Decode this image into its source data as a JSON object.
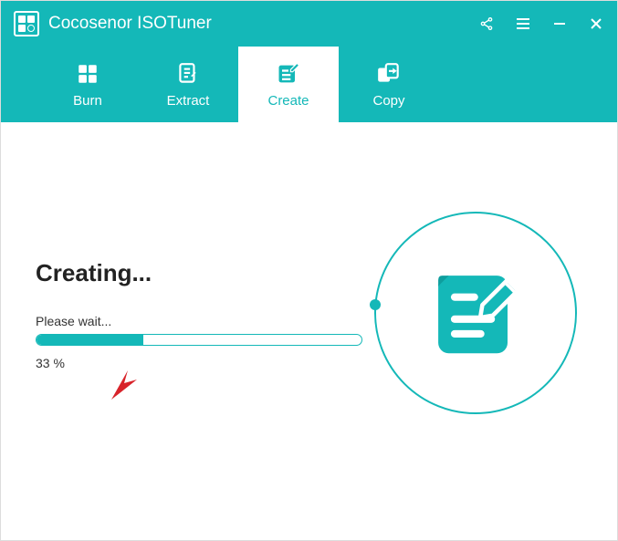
{
  "app": {
    "title": "Cocosenor ISOTuner"
  },
  "tabs": {
    "burn": "Burn",
    "extract": "Extract",
    "create": "Create",
    "copy": "Copy"
  },
  "main": {
    "heading": "Creating...",
    "wait": "Please wait...",
    "percent_text": "33 %",
    "percent_value": 33
  }
}
